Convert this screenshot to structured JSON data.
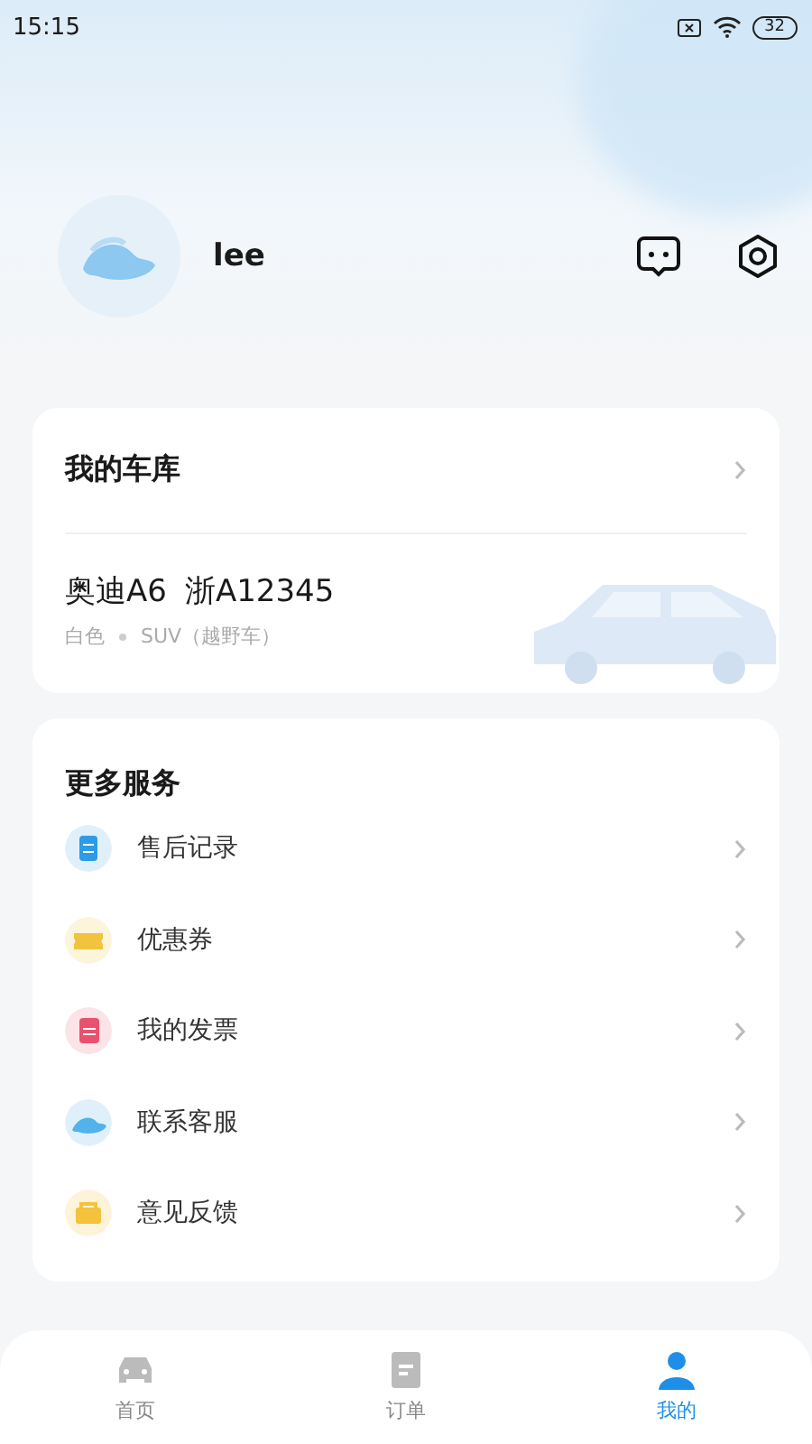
{
  "status_bar": {
    "time": "15:15",
    "battery": "32"
  },
  "profile": {
    "name": "lee"
  },
  "garage": {
    "title": "我的车库",
    "car": {
      "model": "奥迪A6",
      "plate": "浙A12345",
      "paint": "白色",
      "type": "SUV（越野车）"
    }
  },
  "services": {
    "title": "更多服务",
    "items": [
      {
        "label": "售后记录",
        "kind": "record"
      },
      {
        "label": "优惠券",
        "kind": "coupon"
      },
      {
        "label": "我的发票",
        "kind": "invoice"
      },
      {
        "label": "联系客服",
        "kind": "support"
      },
      {
        "label": "意见反馈",
        "kind": "feedback"
      }
    ]
  },
  "tabs": [
    {
      "label": "首页",
      "kind": "home",
      "selected": false
    },
    {
      "label": "订单",
      "kind": "orders",
      "selected": false
    },
    {
      "label": "我的",
      "kind": "me",
      "selected": true
    }
  ]
}
